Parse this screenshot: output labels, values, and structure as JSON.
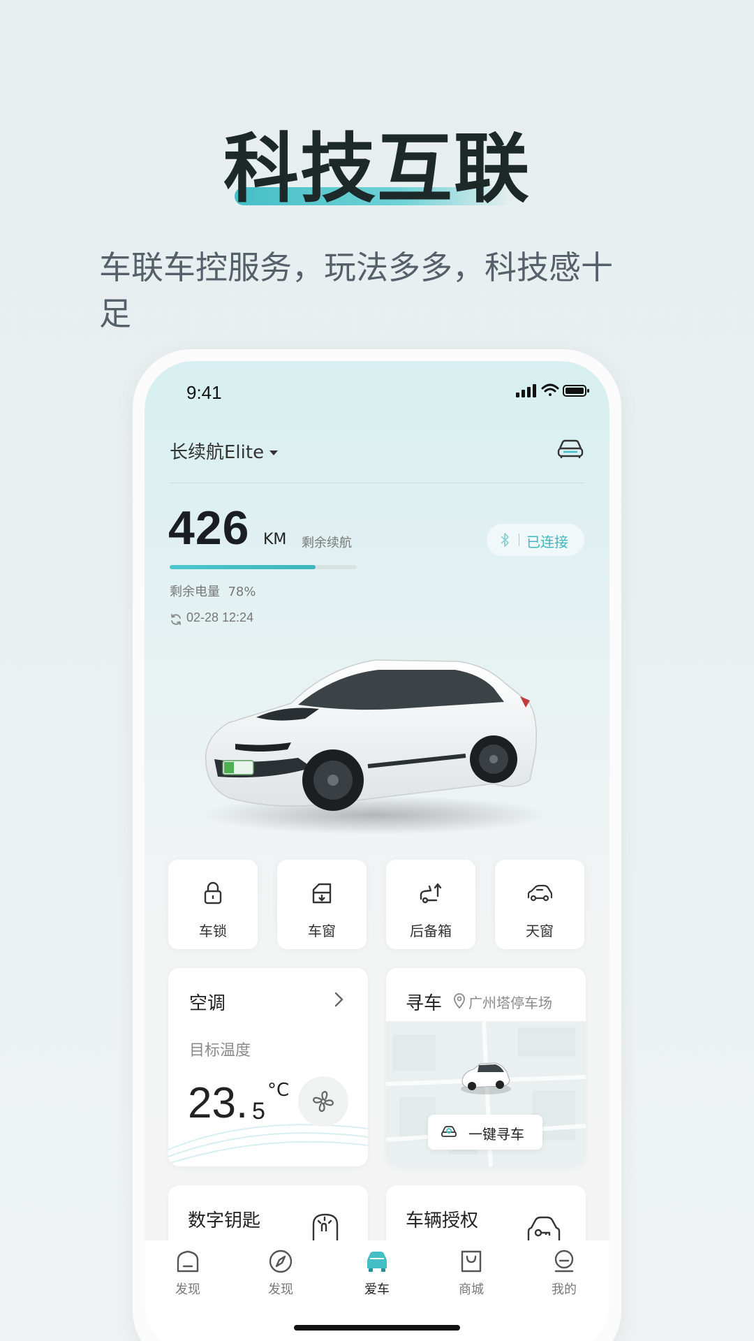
{
  "hero": {
    "title": "科技互联",
    "subtitle": "车联车控服务，玩法多多，科技感十足",
    "accent": "#45bfc6"
  },
  "status_bar": {
    "time": "9:41"
  },
  "vehicle": {
    "name": "长续航Elite",
    "range_value": "426",
    "range_unit": "KM",
    "range_label": "剩余续航",
    "connection": "已连接",
    "battery_label": "剩余电量",
    "battery_percent": "78%",
    "battery_fraction": 0.78,
    "sync_time": "02-28 12:24",
    "icon": "car-outline-icon"
  },
  "quick_controls": [
    {
      "label": "车锁",
      "icon": "lock-icon"
    },
    {
      "label": "车窗",
      "icon": "window-icon"
    },
    {
      "label": "后备箱",
      "icon": "trunk-icon"
    },
    {
      "label": "天窗",
      "icon": "sunroof-icon"
    }
  ],
  "ac": {
    "title": "空调",
    "subtitle": "目标温度",
    "temp_int": "23.",
    "temp_dec": "5",
    "unit": "°C",
    "icon": "fan-icon"
  },
  "find_car": {
    "title": "寻车",
    "location": "广州塔停车场",
    "button_label": "一键寻车",
    "icon": "car-search-icon"
  },
  "digital_key": {
    "title": "数字钥匙",
    "icon": "touch-key-icon"
  },
  "authorization": {
    "title": "车辆授权",
    "icon": "car-key-icon"
  },
  "tabs": [
    {
      "label": "发现",
      "icon": "home-icon"
    },
    {
      "label": "发现",
      "icon": "compass-icon"
    },
    {
      "label": "爱车",
      "icon": "car-icon",
      "active": true
    },
    {
      "label": "商城",
      "icon": "bag-icon"
    },
    {
      "label": "我的",
      "icon": "profile-icon"
    }
  ]
}
